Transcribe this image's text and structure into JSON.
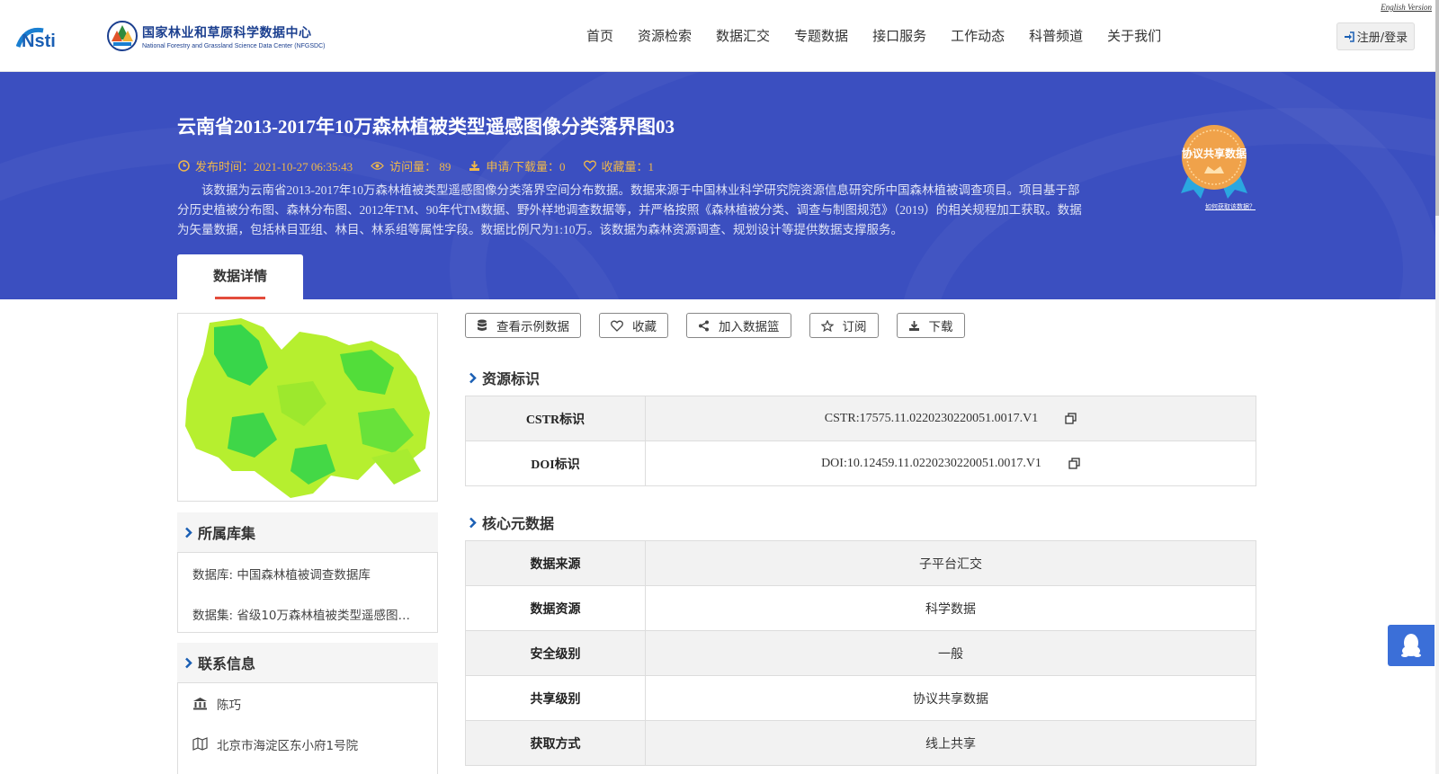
{
  "header": {
    "logo_nsti_alt": "Nsti",
    "logo_cn": "国家林业和草原科学数据中心",
    "logo_en": "National Forestry and Grassland Science Data Center (NFGSDC)",
    "english_version": "English Version",
    "nav": [
      "首页",
      "资源检索",
      "数据汇交",
      "专题数据",
      "接口服务",
      "工作动态",
      "科普频道",
      "关于我们"
    ],
    "login": "注册/登录"
  },
  "banner": {
    "title": "云南省2013-2017年10万森林植被类型遥感图像分类落界图03",
    "publish_time": "发布时间：2021-10-27 06:35:43",
    "visits": "访问量： 89",
    "downloads": "申请/下载量：0",
    "favorites": "收藏量：1",
    "description": "该数据为云南省2013-2017年10万森林植被类型遥感图像分类落界空间分布数据。数据来源于中国林业科学研究院资源信息研究所中国森林植被调查项目。项目基于部分历史植被分布图、森林分布图、2012年TM、90年代TM数据、野外样地调查数据等，并严格按照《森林植被分类、调查与制图规范》（2019）的相关规程加工获取。数据为矢量数据，包括林目亚组、林目、林系组等属性字段。数据比例尺为1:10万。该数据为森林资源调查、规划设计等提供数据支撑服务。",
    "badge_text": "协议共享数据",
    "badge_link": "如何获取该数据？",
    "tab": "数据详情"
  },
  "left": {
    "collection_title": "所属库集",
    "database": "数据库: 中国森林植被调查数据库",
    "dataset": "数据集: 省级10万森林植被类型遥感图…",
    "contact_title": "联系信息",
    "contact_name": "陈巧",
    "contact_address": "北京市海淀区东小府1号院"
  },
  "actions": {
    "sample": "查看示例数据",
    "favorite": "收藏",
    "add_basket": "加入数据篮",
    "subscribe": "订阅",
    "download": "下载"
  },
  "identifiers": {
    "title": "资源标识",
    "rows": [
      {
        "key": "CSTR标识",
        "value": "CSTR:17575.11.0220230220051.0017.V1"
      },
      {
        "key": "DOI标识",
        "value": "DOI:10.12459.11.0220230220051.0017.V1"
      }
    ]
  },
  "core": {
    "title": "核心元数据",
    "rows": [
      {
        "key": "数据来源",
        "value": "子平台汇交"
      },
      {
        "key": "数据资源",
        "value": "科学数据"
      },
      {
        "key": "安全级别",
        "value": "一般"
      },
      {
        "key": "共享级别",
        "value": "协议共享数据"
      },
      {
        "key": "获取方式",
        "value": "线上共享"
      }
    ]
  },
  "colors": {
    "banner": "#3b4fc0",
    "meta": "#f0b84a",
    "tab_underline": "#e34c3c"
  }
}
